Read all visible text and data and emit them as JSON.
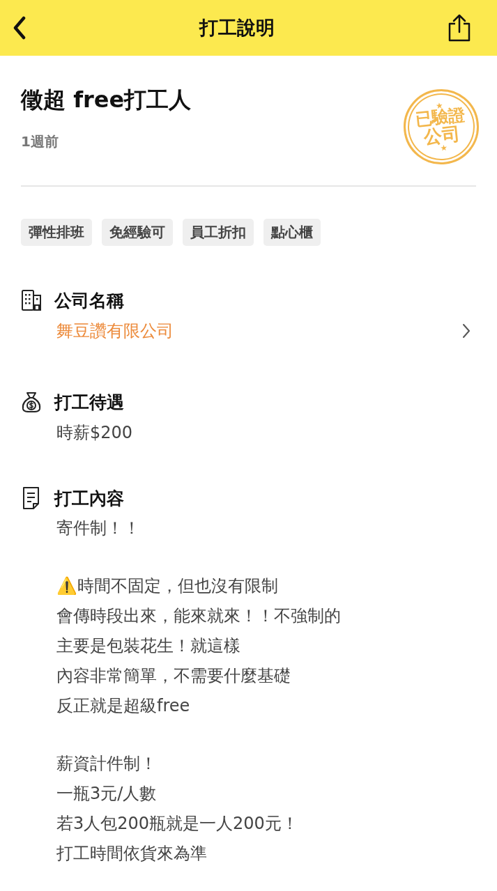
{
  "header": {
    "title": "打工說明"
  },
  "job": {
    "title": "徵超 free打工人",
    "posted": "1週前",
    "stamp": [
      "已驗證",
      "公司"
    ]
  },
  "tags": [
    "彈性排班",
    "免經驗可",
    "員工折扣",
    "點心櫃"
  ],
  "sections": [
    {
      "kind": "company",
      "heading": "公司名稱",
      "value": "舞豆讚有限公司",
      "link": true
    },
    {
      "kind": "pay",
      "heading": "打工待遇",
      "value": "時薪$200",
      "link": false
    },
    {
      "kind": "content",
      "heading": "打工內容",
      "paragraphs": [
        [
          "寄件制！！"
        ],
        [
          "⚠️時間不固定，但也沒有限制",
          "會傳時段出來，能來就來！！不強制的",
          "主要是包裝花生！就這樣",
          "內容非常簡單，不需要什麼基礎",
          "反正就是超級free"
        ],
        [
          "薪資計件制！",
          "一瓶3元/人數",
          "若3人包200瓶就是一人200元！",
          "打工時間依貨來為準"
        ]
      ]
    }
  ]
}
